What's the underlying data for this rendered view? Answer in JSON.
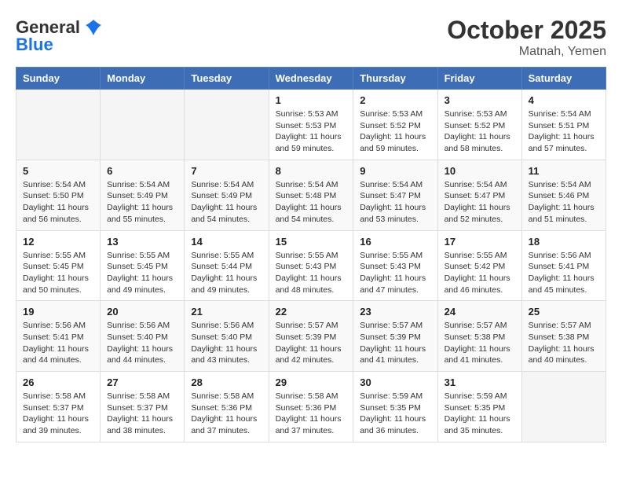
{
  "header": {
    "logo_line1": "General",
    "logo_line2": "Blue",
    "month": "October 2025",
    "location": "Matnah, Yemen"
  },
  "days_of_week": [
    "Sunday",
    "Monday",
    "Tuesday",
    "Wednesday",
    "Thursday",
    "Friday",
    "Saturday"
  ],
  "weeks": [
    [
      {
        "day": "",
        "sunrise": "",
        "sunset": "",
        "daylight": ""
      },
      {
        "day": "",
        "sunrise": "",
        "sunset": "",
        "daylight": ""
      },
      {
        "day": "",
        "sunrise": "",
        "sunset": "",
        "daylight": ""
      },
      {
        "day": "1",
        "sunrise": "Sunrise: 5:53 AM",
        "sunset": "Sunset: 5:53 PM",
        "daylight": "Daylight: 11 hours and 59 minutes."
      },
      {
        "day": "2",
        "sunrise": "Sunrise: 5:53 AM",
        "sunset": "Sunset: 5:52 PM",
        "daylight": "Daylight: 11 hours and 59 minutes."
      },
      {
        "day": "3",
        "sunrise": "Sunrise: 5:53 AM",
        "sunset": "Sunset: 5:52 PM",
        "daylight": "Daylight: 11 hours and 58 minutes."
      },
      {
        "day": "4",
        "sunrise": "Sunrise: 5:54 AM",
        "sunset": "Sunset: 5:51 PM",
        "daylight": "Daylight: 11 hours and 57 minutes."
      }
    ],
    [
      {
        "day": "5",
        "sunrise": "Sunrise: 5:54 AM",
        "sunset": "Sunset: 5:50 PM",
        "daylight": "Daylight: 11 hours and 56 minutes."
      },
      {
        "day": "6",
        "sunrise": "Sunrise: 5:54 AM",
        "sunset": "Sunset: 5:49 PM",
        "daylight": "Daylight: 11 hours and 55 minutes."
      },
      {
        "day": "7",
        "sunrise": "Sunrise: 5:54 AM",
        "sunset": "Sunset: 5:49 PM",
        "daylight": "Daylight: 11 hours and 54 minutes."
      },
      {
        "day": "8",
        "sunrise": "Sunrise: 5:54 AM",
        "sunset": "Sunset: 5:48 PM",
        "daylight": "Daylight: 11 hours and 54 minutes."
      },
      {
        "day": "9",
        "sunrise": "Sunrise: 5:54 AM",
        "sunset": "Sunset: 5:47 PM",
        "daylight": "Daylight: 11 hours and 53 minutes."
      },
      {
        "day": "10",
        "sunrise": "Sunrise: 5:54 AM",
        "sunset": "Sunset: 5:47 PM",
        "daylight": "Daylight: 11 hours and 52 minutes."
      },
      {
        "day": "11",
        "sunrise": "Sunrise: 5:54 AM",
        "sunset": "Sunset: 5:46 PM",
        "daylight": "Daylight: 11 hours and 51 minutes."
      }
    ],
    [
      {
        "day": "12",
        "sunrise": "Sunrise: 5:55 AM",
        "sunset": "Sunset: 5:45 PM",
        "daylight": "Daylight: 11 hours and 50 minutes."
      },
      {
        "day": "13",
        "sunrise": "Sunrise: 5:55 AM",
        "sunset": "Sunset: 5:45 PM",
        "daylight": "Daylight: 11 hours and 49 minutes."
      },
      {
        "day": "14",
        "sunrise": "Sunrise: 5:55 AM",
        "sunset": "Sunset: 5:44 PM",
        "daylight": "Daylight: 11 hours and 49 minutes."
      },
      {
        "day": "15",
        "sunrise": "Sunrise: 5:55 AM",
        "sunset": "Sunset: 5:43 PM",
        "daylight": "Daylight: 11 hours and 48 minutes."
      },
      {
        "day": "16",
        "sunrise": "Sunrise: 5:55 AM",
        "sunset": "Sunset: 5:43 PM",
        "daylight": "Daylight: 11 hours and 47 minutes."
      },
      {
        "day": "17",
        "sunrise": "Sunrise: 5:55 AM",
        "sunset": "Sunset: 5:42 PM",
        "daylight": "Daylight: 11 hours and 46 minutes."
      },
      {
        "day": "18",
        "sunrise": "Sunrise: 5:56 AM",
        "sunset": "Sunset: 5:41 PM",
        "daylight": "Daylight: 11 hours and 45 minutes."
      }
    ],
    [
      {
        "day": "19",
        "sunrise": "Sunrise: 5:56 AM",
        "sunset": "Sunset: 5:41 PM",
        "daylight": "Daylight: 11 hours and 44 minutes."
      },
      {
        "day": "20",
        "sunrise": "Sunrise: 5:56 AM",
        "sunset": "Sunset: 5:40 PM",
        "daylight": "Daylight: 11 hours and 44 minutes."
      },
      {
        "day": "21",
        "sunrise": "Sunrise: 5:56 AM",
        "sunset": "Sunset: 5:40 PM",
        "daylight": "Daylight: 11 hours and 43 minutes."
      },
      {
        "day": "22",
        "sunrise": "Sunrise: 5:57 AM",
        "sunset": "Sunset: 5:39 PM",
        "daylight": "Daylight: 11 hours and 42 minutes."
      },
      {
        "day": "23",
        "sunrise": "Sunrise: 5:57 AM",
        "sunset": "Sunset: 5:39 PM",
        "daylight": "Daylight: 11 hours and 41 minutes."
      },
      {
        "day": "24",
        "sunrise": "Sunrise: 5:57 AM",
        "sunset": "Sunset: 5:38 PM",
        "daylight": "Daylight: 11 hours and 41 minutes."
      },
      {
        "day": "25",
        "sunrise": "Sunrise: 5:57 AM",
        "sunset": "Sunset: 5:38 PM",
        "daylight": "Daylight: 11 hours and 40 minutes."
      }
    ],
    [
      {
        "day": "26",
        "sunrise": "Sunrise: 5:58 AM",
        "sunset": "Sunset: 5:37 PM",
        "daylight": "Daylight: 11 hours and 39 minutes."
      },
      {
        "day": "27",
        "sunrise": "Sunrise: 5:58 AM",
        "sunset": "Sunset: 5:37 PM",
        "daylight": "Daylight: 11 hours and 38 minutes."
      },
      {
        "day": "28",
        "sunrise": "Sunrise: 5:58 AM",
        "sunset": "Sunset: 5:36 PM",
        "daylight": "Daylight: 11 hours and 37 minutes."
      },
      {
        "day": "29",
        "sunrise": "Sunrise: 5:58 AM",
        "sunset": "Sunset: 5:36 PM",
        "daylight": "Daylight: 11 hours and 37 minutes."
      },
      {
        "day": "30",
        "sunrise": "Sunrise: 5:59 AM",
        "sunset": "Sunset: 5:35 PM",
        "daylight": "Daylight: 11 hours and 36 minutes."
      },
      {
        "day": "31",
        "sunrise": "Sunrise: 5:59 AM",
        "sunset": "Sunset: 5:35 PM",
        "daylight": "Daylight: 11 hours and 35 minutes."
      },
      {
        "day": "",
        "sunrise": "",
        "sunset": "",
        "daylight": ""
      }
    ]
  ]
}
